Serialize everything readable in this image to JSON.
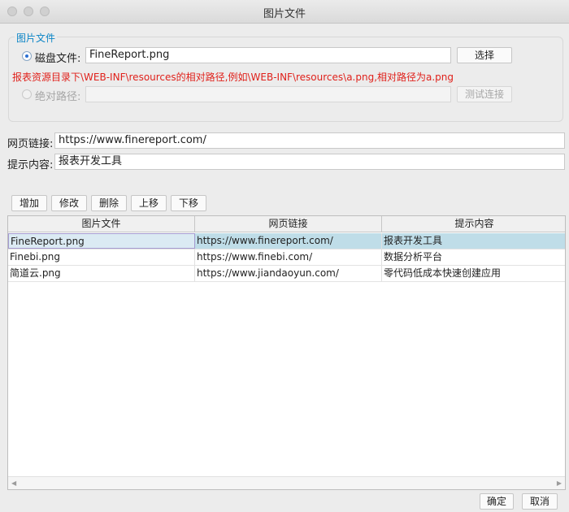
{
  "window": {
    "title": "图片文件"
  },
  "image_group": {
    "legend": "图片文件",
    "disk_label": "磁盘文件:",
    "disk_value": "FineReport.png",
    "choose_button": "选择",
    "hint": "报表资源目录下\\WEB-INF\\resources的相对路径,例如\\WEB-INF\\resources\\a.png,相对路径为a.png",
    "absolute_label": "绝对路径:",
    "absolute_value": "",
    "test_button": "测试连接"
  },
  "fields": {
    "link_label": "网页链接:",
    "link_value": "https://www.finereport.com/",
    "tip_label": "提示内容:",
    "tip_value": "报表开发工具"
  },
  "toolbar": {
    "add": "增加",
    "edit": "修改",
    "delete": "删除",
    "up": "上移",
    "down": "下移"
  },
  "table": {
    "columns": [
      "图片文件",
      "网页链接",
      "提示内容"
    ],
    "rows": [
      [
        "FineReport.png",
        "https://www.finereport.com/",
        "报表开发工具"
      ],
      [
        "Finebi.png",
        "https://www.finebi.com/",
        "数据分析平台"
      ],
      [
        "简道云.png",
        "https://www.jiandaoyun.com/",
        "零代码低成本快速创建应用"
      ]
    ],
    "selected_row": 0
  },
  "footer": {
    "ok": "确定",
    "cancel": "取消"
  },
  "colors": {
    "legend": "#0a84c6",
    "hint": "#e0211b",
    "selected_row": "#bfdde8"
  }
}
